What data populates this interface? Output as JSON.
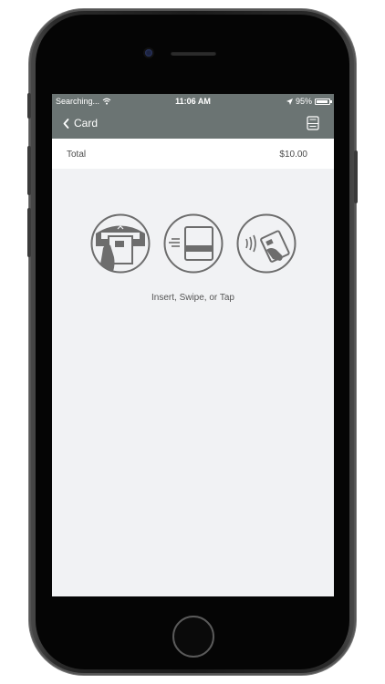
{
  "status_bar": {
    "carrier": "Searching...",
    "time": "11:06 AM",
    "battery": "95%",
    "battery_level": 0.95
  },
  "nav": {
    "back_label": "Card",
    "icons": [
      "chevron-left-icon",
      "register-icon"
    ]
  },
  "payment": {
    "total_label": "Total",
    "total_amount": "$10.00"
  },
  "card_methods": {
    "icons": [
      "insert-card-icon",
      "swipe-card-icon",
      "tap-card-icon"
    ],
    "instruction": "Insert, Swipe, or Tap"
  },
  "colors": {
    "header": "#6b7473",
    "screen_background": "#f1f2f4",
    "icon_stroke": "#6d6d6d"
  }
}
